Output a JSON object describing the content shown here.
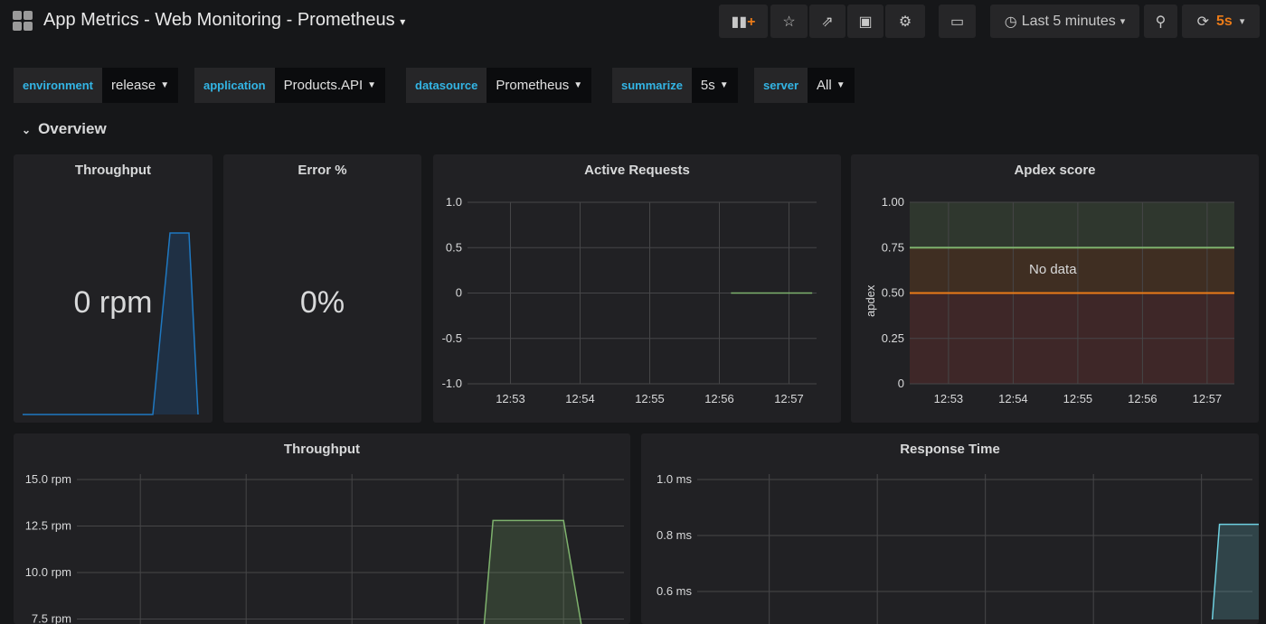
{
  "header": {
    "title": "App Metrics - Web Monitoring - Prometheus",
    "time_range": "Last 5 minutes",
    "refresh": "5s",
    "icons": [
      "add-panel-icon",
      "star-icon",
      "share-icon",
      "save-icon",
      "gear-icon",
      "tv-mode-icon",
      "clock-icon",
      "zoom-out-icon",
      "refresh-icon"
    ]
  },
  "variables": [
    {
      "label": "environment",
      "value": "release"
    },
    {
      "label": "application",
      "value": "Products.API"
    },
    {
      "label": "datasource",
      "value": "Prometheus"
    },
    {
      "label": "summarize",
      "value": "5s"
    },
    {
      "label": "server",
      "value": "All"
    }
  ],
  "row": {
    "title": "Overview"
  },
  "colors": {
    "accent": "#33b5e5",
    "refresh": "#eb7b18",
    "green": "#7eb26d",
    "blue": "#1f78c1",
    "orange": "#eb7b18",
    "cyan": "#6ed0e0"
  },
  "panels": {
    "throughput_stat": {
      "title": "Throughput",
      "value": "0 rpm"
    },
    "error_stat": {
      "title": "Error %",
      "value": "0%"
    },
    "active": {
      "title": "Active Requests"
    },
    "apdex": {
      "title": "Apdex score",
      "ylabel": "apdex",
      "nodata": "No data"
    },
    "throughput": {
      "title": "Throughput"
    },
    "response": {
      "title": "Response Time"
    }
  },
  "chart_data": [
    {
      "type": "line",
      "title": "Active Requests",
      "x_ticks": [
        "12:53",
        "12:54",
        "12:55",
        "12:56",
        "12:57"
      ],
      "y_ticks": [
        "1.0",
        "0.5",
        "0",
        "-0.5",
        "-1.0"
      ],
      "ylim": [
        -1,
        1
      ],
      "xlim": [
        "12:52:23",
        "12:57:25"
      ],
      "grid": true,
      "series": [
        {
          "color": "#7eb26d",
          "points": [
            [
              "12:56:10",
              0
            ],
            [
              "12:57:20",
              0
            ]
          ]
        }
      ]
    },
    {
      "type": "area",
      "title": "Apdex score",
      "ylabel": "apdex",
      "x_ticks": [
        "12:53",
        "12:54",
        "12:55",
        "12:56",
        "12:57"
      ],
      "y_ticks": [
        "1.00",
        "0.75",
        "0.50",
        "0.25",
        "0"
      ],
      "ylim": [
        0,
        1
      ],
      "xlim": [
        "12:52:24",
        "12:57:25"
      ],
      "grid": true,
      "thresholds": [
        {
          "from": 0.75,
          "to": 1,
          "color": "#7eb26d"
        },
        {
          "from": 0.5,
          "to": 0.75,
          "color": "#eb7b18"
        },
        {
          "from": 0,
          "to": 0.5,
          "color": "#e24d42"
        }
      ],
      "annotation": "No data"
    },
    {
      "type": "area",
      "title": "Throughput",
      "y_ticks": [
        "15.0 rpm",
        "12.5 rpm",
        "10.0 rpm",
        "7.5 rpm"
      ],
      "ylim": [
        7.5,
        15
      ],
      "grid": true,
      "series": [
        {
          "color": "#7eb26d",
          "points": [
            [
              "12:56:15",
              0
            ],
            [
              "12:56:20",
              12.8
            ],
            [
              "12:57:00",
              12.8
            ],
            [
              "12:57:10",
              0
            ]
          ]
        }
      ]
    },
    {
      "type": "area",
      "title": "Response Time",
      "y_ticks": [
        "1.0 ms",
        "0.8 ms",
        "0.6 ms"
      ],
      "ylim": [
        0.6,
        1.0
      ],
      "grid": true,
      "series": [
        {
          "color": "#6ed0e0",
          "points": [
            [
              "12:57:06",
              0.5
            ],
            [
              "12:57:10",
              0.84
            ],
            [
              "12:57:33",
              0.84
            ]
          ]
        }
      ]
    }
  ]
}
